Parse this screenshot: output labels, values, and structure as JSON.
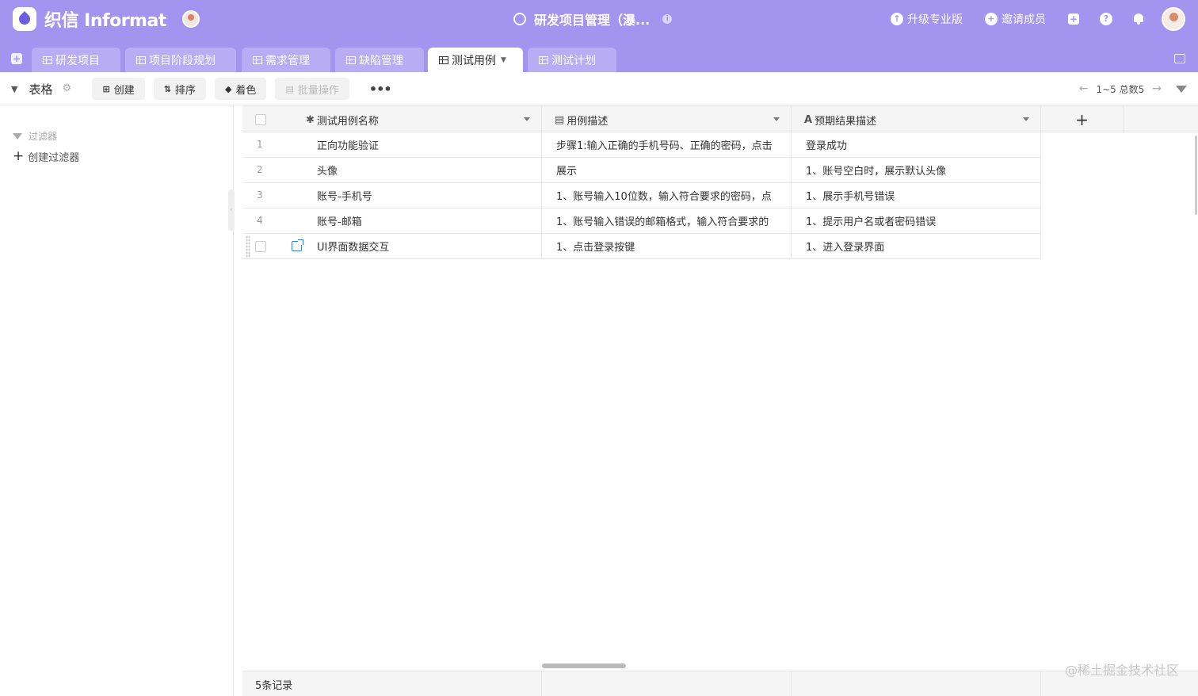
{
  "brand": {
    "name": "织信 Informat"
  },
  "header": {
    "title": "研发项目管理（瀑...",
    "actions": {
      "upgrade": "升级专业版",
      "invite": "邀请成员"
    }
  },
  "tabs": [
    {
      "label": "研发项目"
    },
    {
      "label": "项目阶段规划"
    },
    {
      "label": "需求管理"
    },
    {
      "label": "缺陷管理"
    },
    {
      "label": "测试用例"
    },
    {
      "label": "测试计划"
    }
  ],
  "active_tab": "测试用例",
  "toolbar": {
    "view_title": "表格",
    "create": "创建",
    "sort": "排序",
    "color": "着色",
    "batch": "批量操作",
    "more": "•••",
    "pagination": "1~5 总数5"
  },
  "sidebar": {
    "filter_title": "过滤器",
    "create_filter": "创建过滤器"
  },
  "columns": [
    {
      "icon": "✱",
      "label": "测试用例名称"
    },
    {
      "icon": "▤",
      "label": "用例描述"
    },
    {
      "icon": "A",
      "label": "预期结果描述"
    }
  ],
  "add_column": "+",
  "rows": [
    {
      "num": "1",
      "name": "正向功能验证",
      "desc": "步骤1:输入正确的手机号码、正确的密码，点击",
      "expected": "登录成功"
    },
    {
      "num": "2",
      "name": "头像",
      "desc": "展示",
      "expected": "1、账号空白时，展示默认头像"
    },
    {
      "num": "3",
      "name": "账号-手机号",
      "desc": "1、账号输入10位数，输入符合要求的密码，点",
      "expected": "1、展示手机号错误"
    },
    {
      "num": "4",
      "name": "账号-邮箱",
      "desc": "1、账号输入错误的邮箱格式，输入符合要求的",
      "expected": "1、提示用户名或者密码错误"
    },
    {
      "num": "",
      "name": "UI界面数据交互",
      "desc": "1、点击登录按键",
      "expected": "1、进入登录界面"
    }
  ],
  "footer": {
    "record_count": "5条记录"
  },
  "watermark": "@稀土掘金技术社区"
}
